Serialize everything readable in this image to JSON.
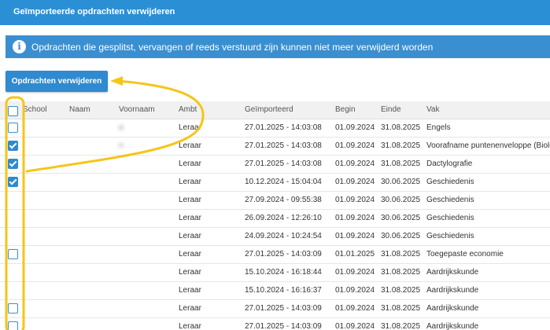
{
  "header": {
    "title": "Geïmporteerde opdrachten verwijderen"
  },
  "info": {
    "icon": "info-icon",
    "text": "Opdrachten die gesplitst, vervangen of reeds verstuurd zijn kunnen niet meer verwijderd worden"
  },
  "toolbar": {
    "delete_label": "Opdrachten verwijderen"
  },
  "table": {
    "columns": [
      "School",
      "Naam",
      "Voornaam",
      "Ambt",
      "Geïmporteerd",
      "Begin",
      "Einde",
      "Vak"
    ],
    "rows": [
      {
        "checkbox": "unchecked",
        "school": "",
        "naam": "",
        "voornaam": "a",
        "ambt": "Leraar",
        "geimporteerd": "27.01.2025 - 14:03:08",
        "begin": "01.09.2024",
        "einde": "31.08.2025",
        "vak": "Engels"
      },
      {
        "checkbox": "checked",
        "school": "",
        "naam": "",
        "voornaam": "n",
        "ambt": "Leraar",
        "geimporteerd": "27.01.2025 - 14:03:08",
        "begin": "01.09.2024",
        "einde": "31.08.2025",
        "vak": "Voorafname puntenenveloppe (Biolo"
      },
      {
        "checkbox": "checked",
        "school": "",
        "naam": "",
        "voornaam": "",
        "ambt": "Leraar",
        "geimporteerd": "27.01.2025 - 14:03:08",
        "begin": "01.09.2024",
        "einde": "31.08.2025",
        "vak": "Dactylografie"
      },
      {
        "checkbox": "checked",
        "school": "",
        "naam": "",
        "voornaam": "",
        "ambt": "Leraar",
        "geimporteerd": "10.12.2024 - 15:04:04",
        "begin": "01.09.2024",
        "einde": "30.06.2025",
        "vak": "Geschiedenis"
      },
      {
        "checkbox": "none",
        "school": "",
        "naam": "",
        "voornaam": "",
        "ambt": "Leraar",
        "geimporteerd": "27.09.2024 - 09:55:38",
        "begin": "01.09.2024",
        "einde": "30.06.2025",
        "vak": "Geschiedenis"
      },
      {
        "checkbox": "none",
        "school": "",
        "naam": "",
        "voornaam": "",
        "ambt": "Leraar",
        "geimporteerd": "26.09.2024 - 12:26:10",
        "begin": "01.09.2024",
        "einde": "30.06.2025",
        "vak": "Geschiedenis"
      },
      {
        "checkbox": "none",
        "school": "",
        "naam": "",
        "voornaam": "",
        "ambt": "Leraar",
        "geimporteerd": "24.09.2024 - 10:24:54",
        "begin": "01.09.2024",
        "einde": "30.06.2025",
        "vak": "Geschiedenis"
      },
      {
        "checkbox": "unchecked",
        "school": "",
        "naam": "",
        "voornaam": "",
        "ambt": "Leraar",
        "geimporteerd": "27.01.2025 - 14:03:09",
        "begin": "01.01.2025",
        "einde": "31.08.2025",
        "vak": "Toegepaste economie"
      },
      {
        "checkbox": "none",
        "school": "",
        "naam": "",
        "voornaam": "",
        "ambt": "Leraar",
        "geimporteerd": "15.10.2024 - 16:18:44",
        "begin": "01.09.2024",
        "einde": "31.08.2025",
        "vak": "Aardrijkskunde"
      },
      {
        "checkbox": "none",
        "school": "",
        "naam": "",
        "voornaam": "",
        "ambt": "Leraar",
        "geimporteerd": "15.10.2024 - 16:16:37",
        "begin": "01.09.2024",
        "einde": "31.08.2025",
        "vak": "Aardrijkskunde"
      },
      {
        "checkbox": "unchecked",
        "school": "",
        "naam": "",
        "voornaam": "",
        "ambt": "Leraar",
        "geimporteerd": "27.01.2025 - 14:03:09",
        "begin": "01.09.2024",
        "einde": "31.08.2025",
        "vak": "Aardrijkskunde"
      },
      {
        "checkbox": "unchecked",
        "school": "",
        "naam": "",
        "voornaam": "",
        "ambt": "Leraar",
        "geimporteerd": "27.01.2025 - 14:03:09",
        "begin": "01.09.2024",
        "einde": "31.08.2025",
        "vak": "Aardrijkskunde"
      }
    ]
  },
  "colors": {
    "header_bg": "#2b8fd6",
    "banner_bg": "#3a8fd1",
    "button_bg": "#2f8ad0",
    "annotation": "#f5c518"
  }
}
